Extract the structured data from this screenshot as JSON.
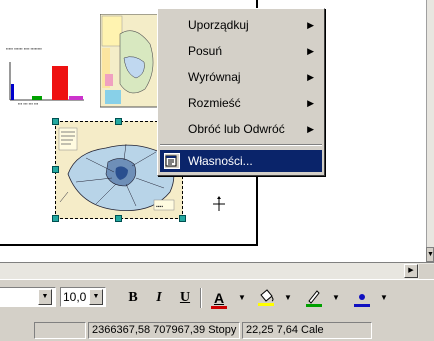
{
  "context_menu": {
    "items": [
      {
        "label": "Uporządkuj",
        "has_submenu": true,
        "selected": false
      },
      {
        "label": "Posuń",
        "has_submenu": true,
        "selected": false
      },
      {
        "label": "Wyrównaj",
        "has_submenu": true,
        "selected": false
      },
      {
        "label": "Rozmieść",
        "has_submenu": true,
        "selected": false
      },
      {
        "label": "Obróć lub Odwróć",
        "has_submenu": true,
        "selected": false
      },
      {
        "label": "Własności...",
        "has_submenu": false,
        "selected": true,
        "icon": "properties-icon"
      }
    ]
  },
  "toolbar": {
    "font_size": "10,0",
    "bold": "B",
    "italic": "I",
    "underline": "U",
    "font_color_glyph": "A",
    "colors": {
      "font": "#cc0000",
      "fill": "#ffff00",
      "line": "#00a000",
      "point": "#1010c0"
    }
  },
  "statusbar": {
    "coordinates": "2366367,58 707967,39 Stopy",
    "size": "22,25 7,64 Cale"
  },
  "bar_chart": {
    "colors": [
      "#0000cc",
      "#00a000",
      "#ee1111",
      "#cc33cc"
    ]
  }
}
